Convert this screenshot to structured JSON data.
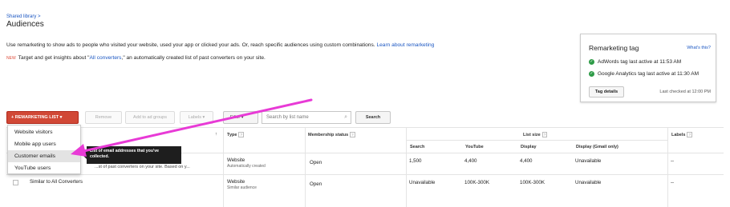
{
  "breadcrumb": "Shared library >",
  "page_title": "Audiences",
  "intro": {
    "text": "Use remarketing to show ads to people who visited your website, used your app or clicked your ads. Or, reach specific audiences using custom combinations.",
    "link": "Learn about remarketing"
  },
  "news": {
    "badge": "NEW",
    "text_before": "Target and get insights about \"",
    "link": "All converters",
    "text_after": ",\" an automatically created list of past converters on your site."
  },
  "remarketing_tag": {
    "title": "Remarketing tag",
    "whats_this": "What's this?",
    "status_1": "AdWords tag last active at 11:53 AM",
    "status_2": "Google Analytics tag last active at 11:30 AM",
    "details_button": "Tag details",
    "last_checked": "Last checked at 12:00 PM"
  },
  "toolbar": {
    "remarketing_list": "REMARKETING LIST",
    "remove": "Remove",
    "add_to_ad_groups": "Add to ad groups",
    "labels": "Labels",
    "filter": "Filter",
    "search_placeholder": "Search by list name",
    "search_button": "Search"
  },
  "menu": {
    "items": [
      "Website visitors",
      "Mobile app users",
      "Customer emails",
      "YouTube users"
    ],
    "tooltip": "List of email addresses that you've collected."
  },
  "table": {
    "headers": {
      "type": "Type",
      "membership_status": "Membership status",
      "list_size": "List size",
      "labels": "Labels",
      "search": "Search",
      "youtube": "YouTube",
      "display": "Display",
      "display_gmail": "Display (Gmail only)"
    },
    "rows": [
      {
        "name": "",
        "desc": "...st of past converters on your site. Based on y...",
        "type": "Website",
        "type_sub": "Automatically created",
        "membership": "Open",
        "search": "1,500",
        "youtube": "4,400",
        "display": "4,400",
        "display_gmail": "Unavailable",
        "labels": "--"
      },
      {
        "name": "Similar to All Converters",
        "desc": "",
        "type": "Website",
        "type_sub": "Similar audience",
        "membership": "Open",
        "search": "Unavailable",
        "youtube": "100K-300K",
        "display": "100K-300K",
        "display_gmail": "Unavailable",
        "labels": "--"
      }
    ]
  },
  "colors": {
    "accent": "#d14836",
    "link": "#1a56c2",
    "arrow": "#e83ad6",
    "status_ok": "#2e9b47"
  }
}
